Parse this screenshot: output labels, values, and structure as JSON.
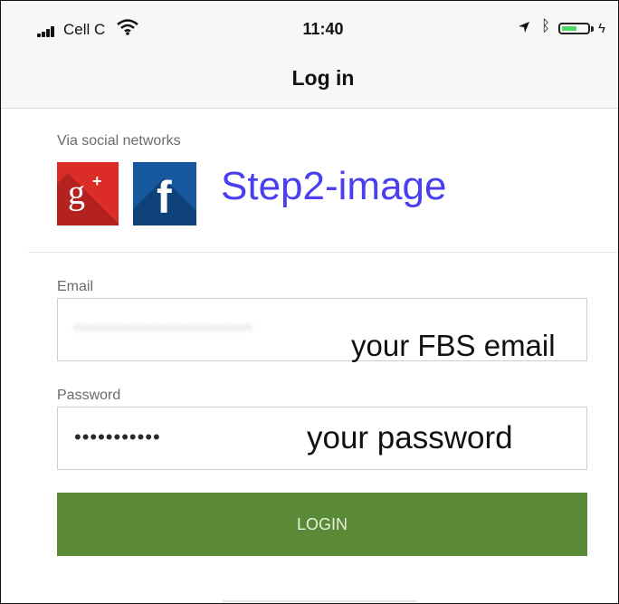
{
  "status_bar": {
    "carrier": "Cell C",
    "time": "11:40",
    "battery_level": 0.6,
    "colors": {
      "battery": "#4cd964"
    },
    "icons": [
      "signal-icon",
      "wifi-icon",
      "location-icon",
      "bluetooth-icon",
      "battery-icon",
      "charging-icon"
    ]
  },
  "nav": {
    "title": "Log in"
  },
  "social": {
    "label": "Via social networks",
    "buttons": [
      {
        "name": "google-plus",
        "glyph": "g",
        "superscript": "+",
        "color": "#dc2c27"
      },
      {
        "name": "facebook",
        "glyph": "f",
        "color": "#17599f"
      }
    ],
    "step_annotation": "Step2-image"
  },
  "form": {
    "email": {
      "label": "Email",
      "annotation": "your FBS email"
    },
    "password": {
      "label": "Password",
      "value_masked": "•••••••••••",
      "annotation": "your password"
    },
    "login_label": "LOGIN",
    "colors": {
      "login_button": "#5a8a36",
      "annotation_text": "#4a3ff0"
    }
  }
}
